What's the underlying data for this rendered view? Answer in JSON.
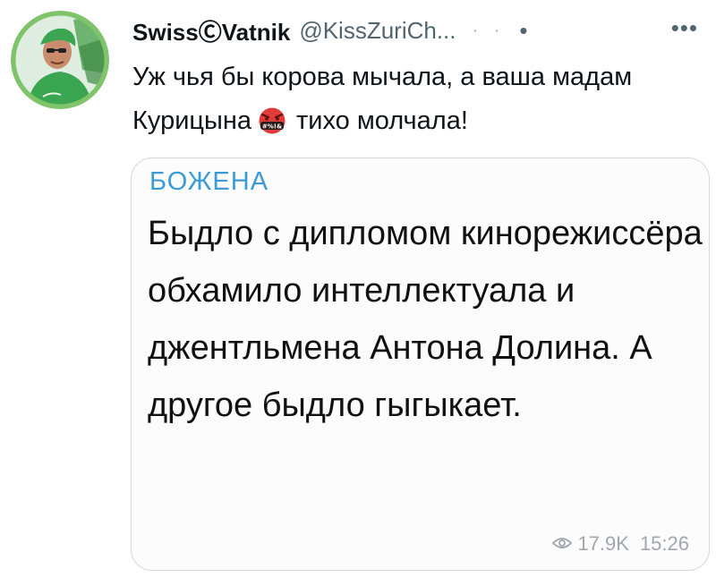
{
  "author": {
    "display_name": "SwissⒸVatnik",
    "handle": "@KissZuriCh...",
    "faint_dots": "· ·",
    "separator": "•",
    "more_label": "•••"
  },
  "tweet": {
    "text_part1": "Уж чья бы корова мычала, а ваша мадам Курицына",
    "emoji_icon": "face-with-symbols-on-mouth-icon",
    "text_part2": "тихо молчала!"
  },
  "quoted_card": {
    "author": "БОЖЕНА",
    "text": "Быдло с дипломом кинорежиссёра обхамило интеллектуала и джентльмена Антона Долина. А другое быдло гыгыкает.",
    "views": "17.9K",
    "time": "15:26",
    "views_icon": "eye-icon"
  },
  "colors": {
    "text": "#0f1419",
    "secondary": "#536471",
    "card_author": "#3b9bd6",
    "card_border": "#cfd9de",
    "avatar_ring": "#7fc36a",
    "emoji_red": "#e03a3a"
  }
}
